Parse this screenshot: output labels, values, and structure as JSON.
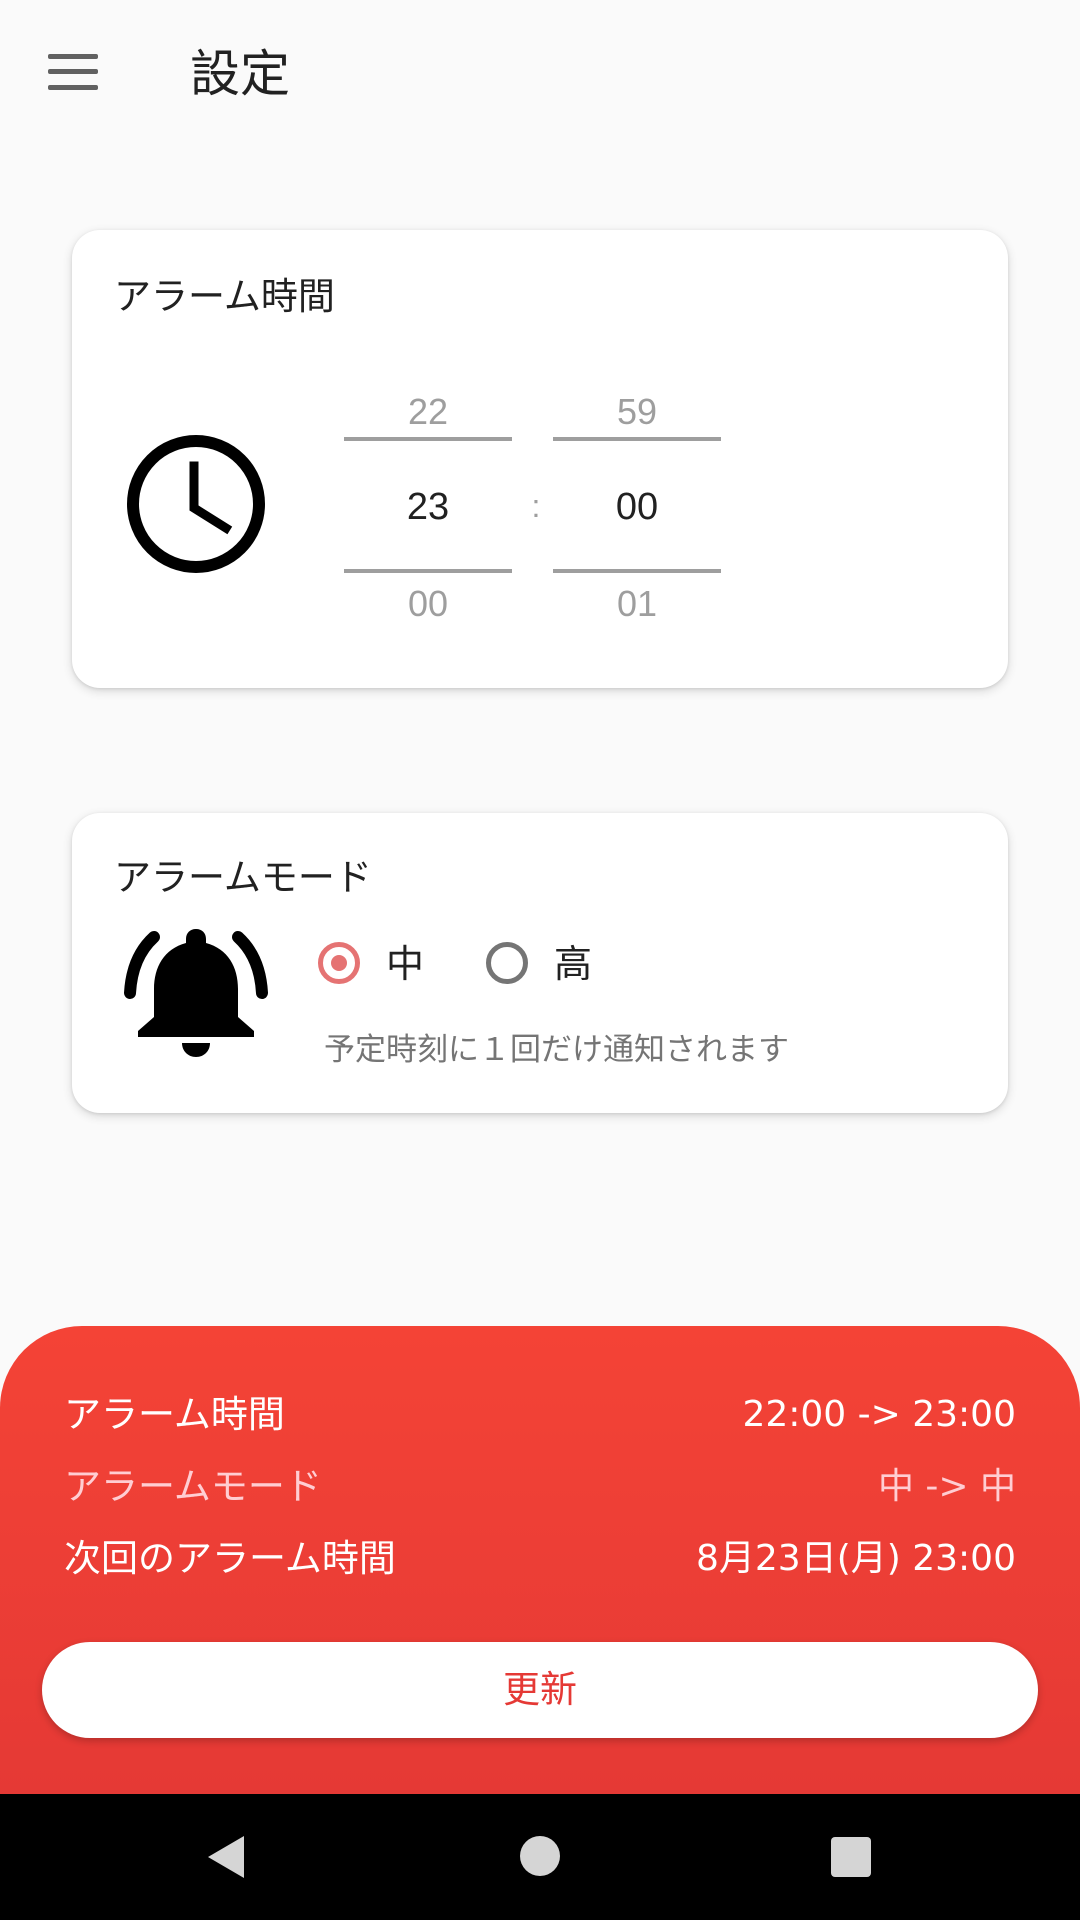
{
  "appbar": {
    "title": "設定",
    "menu_icon": "hamburger-menu-icon"
  },
  "alarm_time_card": {
    "title": "アラーム時間",
    "icon": "clock-icon",
    "hour": {
      "prev": "22",
      "current": "23",
      "next": "00"
    },
    "minute": {
      "prev": "59",
      "current": "00",
      "next": "01"
    },
    "separator": ":"
  },
  "alarm_mode_card": {
    "title": "アラームモード",
    "icon": "bell-icon",
    "options": [
      {
        "label": "中",
        "selected": true
      },
      {
        "label": "高",
        "selected": false
      }
    ],
    "description": "予定時刻に１回だけ通知されます"
  },
  "summary": {
    "rows": [
      {
        "label": "アラーム時間",
        "value": "22:00 -> 23:00"
      },
      {
        "label": "アラームモード",
        "value": "中 -> 中"
      },
      {
        "label": "次回のアラーム時間",
        "value": "8月23日(月) 23:00"
      }
    ],
    "update_button": "更新"
  },
  "colors": {
    "accent": "#f44336",
    "radio_selected": "#e57373",
    "panel_muted_text": "#ffcdd2"
  },
  "nav_bar": {
    "back_icon": "back-triangle-icon",
    "home_icon": "home-circle-icon",
    "recents_icon": "recents-square-icon"
  }
}
